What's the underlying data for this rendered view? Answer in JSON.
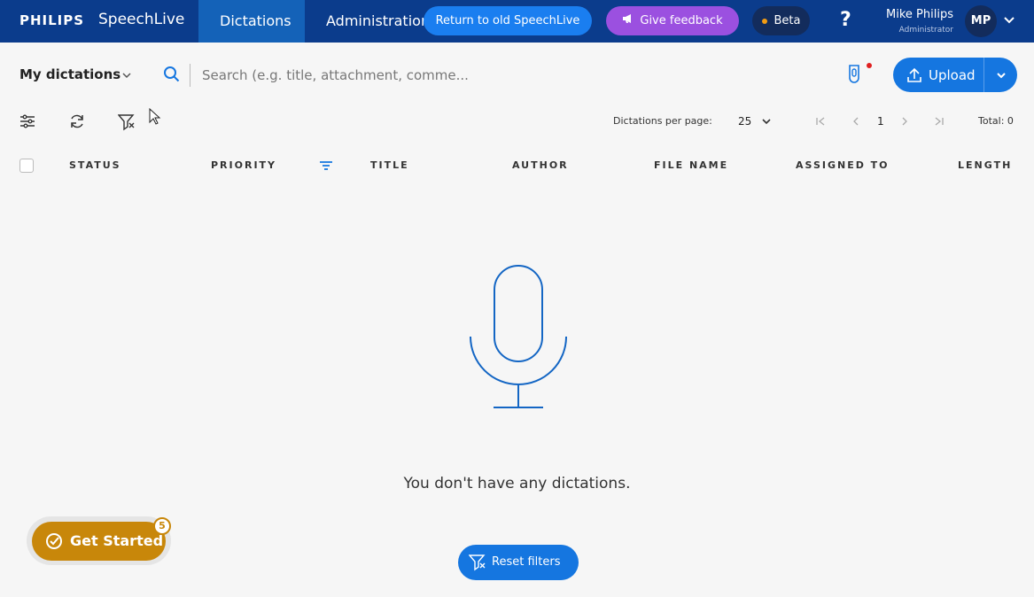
{
  "header": {
    "brand": "PHILIPS",
    "product": "SpeechLive",
    "nav": [
      {
        "label": "Dictations",
        "active": true
      },
      {
        "label": "Administration",
        "active": false
      }
    ],
    "return_button": "Return to old SpeechLive",
    "feedback_button": "Give feedback",
    "beta_label": "Beta",
    "help_label": "?",
    "user": {
      "name": "Mike Philips",
      "role": "Administrator",
      "initials": "MP"
    }
  },
  "toolbar": {
    "view_select": "My dictations",
    "search_placeholder": "Search (e.g. title, attachment, comme...",
    "upload_label": "Upload",
    "icons": [
      "columns-settings-icon",
      "refresh-icon",
      "clear-filter-icon"
    ]
  },
  "pagination": {
    "per_page_label": "Dictations per page:",
    "per_page_value": "25",
    "current_page": "1",
    "total_label": "Total: 0"
  },
  "table": {
    "columns": [
      "STATUS",
      "PRIORITY",
      "TITLE",
      "AUTHOR",
      "FILE NAME",
      "ASSIGNED TO",
      "LENGTH"
    ]
  },
  "empty_state": {
    "message": "You don't have any dictations.",
    "reset_button": "Reset filters"
  },
  "get_started": {
    "label": "Get Started",
    "badge": "5"
  },
  "colors": {
    "header_bg": "#0b3c8c",
    "active_tab": "#1462b8",
    "primary": "#1576e0",
    "feedback": "#9b50e0",
    "get_started": "#c8870a"
  }
}
